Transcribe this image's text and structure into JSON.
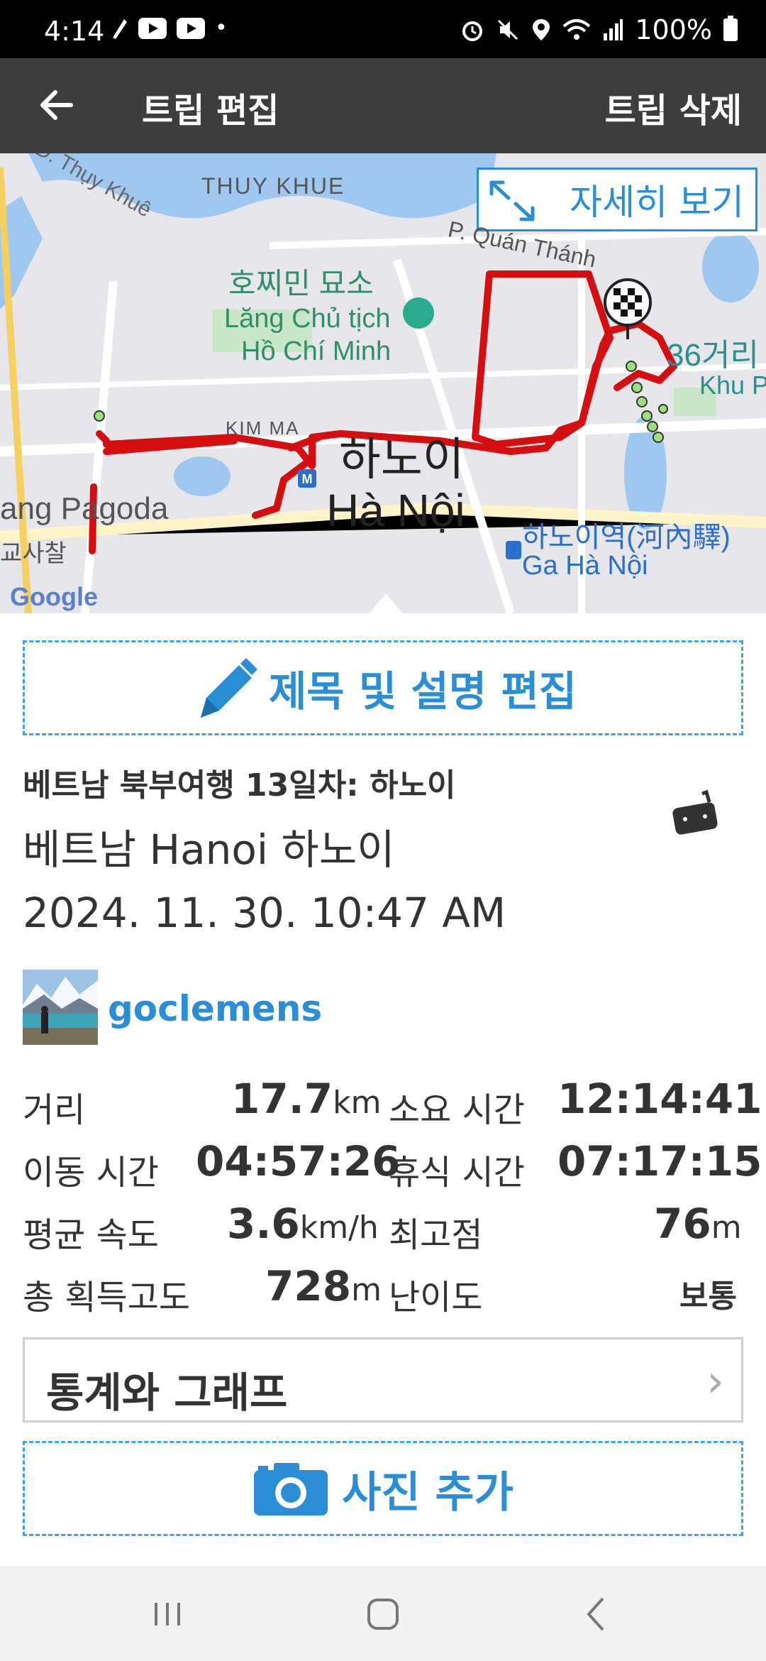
{
  "status_bar": {
    "time": "4:14",
    "battery": "100%"
  },
  "app_bar": {
    "title": "트립 편집",
    "delete_label": "트립 삭제"
  },
  "map": {
    "detail_button": "자세히 보기",
    "labels": {
      "thuy_khue_street": "D. Thụy Khuê",
      "thuy_khue": "THUY KHUE",
      "mausoleum_ko": "호찌민 묘소",
      "mausoleum_vi_1": "Lăng Chủ tịch",
      "mausoleum_vi_2": "Hồ Chí Minh",
      "quan_thanh": "P. Quán Thánh",
      "kim_ma": "KIM MA",
      "hanoi_ko": "하노이",
      "hanoi_vi": "Hà Nội",
      "pagoda": "ang Pagoda",
      "pagoda_ko": "교사찰",
      "station_ko": "하노이역(河內驛)",
      "station_vi": "Ga Hà Nội",
      "old_quarter_ko": "36거리",
      "old_quarter_vi": "Khu Phố",
      "google": "Google"
    }
  },
  "edit_button": "제목 및 설명 편집",
  "trip": {
    "title": "베트남 북부여행 13일차: 하노이",
    "location": "베트남 Hanoi 하노이",
    "datetime": "2024. 11. 30. 10:47 AM",
    "username": "goclemens"
  },
  "stats": {
    "distance_label": "거리",
    "distance_value": "17.7",
    "distance_unit": "km",
    "duration_label": "소요 시간",
    "duration_value": "12:14:41",
    "moving_label": "이동 시간",
    "moving_value": "04:57:26",
    "rest_label": "휴식 시간",
    "rest_value": "07:17:15",
    "speed_label": "평균 속도",
    "speed_value": "3.6",
    "speed_unit": "km/h",
    "highest_label": "최고점",
    "highest_value": "76",
    "highest_unit": "m",
    "gain_label": "총 획득고도",
    "gain_value": "728",
    "gain_unit": "m",
    "difficulty_label": "난이도",
    "difficulty_value": "보통"
  },
  "graph_button": "통계와 그래프",
  "photo_button": "사진 추가",
  "colors": {
    "accent": "#2a8ed6",
    "route": "#d50f0f",
    "appbar": "#3d3d3d"
  }
}
